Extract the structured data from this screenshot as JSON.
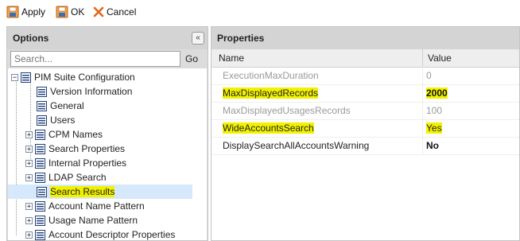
{
  "toolbar": {
    "apply_label": "Apply",
    "ok_label": "OK",
    "cancel_label": "Cancel"
  },
  "options": {
    "title": "Options",
    "collapse_symbol": "«",
    "search_placeholder": "Search...",
    "go_label": "Go",
    "tree": {
      "root": "PIM Suite Configuration",
      "items": [
        "Version Information",
        "General",
        "Users",
        "CPM Names",
        "Search Properties",
        "Internal Properties",
        "LDAP Search",
        "Search Results",
        "Account Name Pattern",
        "Usage Name Pattern",
        "Account Descriptor Properties"
      ]
    }
  },
  "properties": {
    "title": "Properties",
    "col_name": "Name",
    "col_value": "Value",
    "rows": [
      {
        "name": "ExecutionMaxDuration",
        "value": "0"
      },
      {
        "name": "MaxDisplayedRecords",
        "value": "2000"
      },
      {
        "name": "MaxDisplayedUsagesRecords",
        "value": "100"
      },
      {
        "name": "WideAccountsSearch",
        "value": "Yes"
      },
      {
        "name": "DisplaySearchAllAccountsWarning",
        "value": "No"
      }
    ]
  },
  "colors": {
    "highlight": "#f2f200",
    "selection": "#d6e8fb",
    "panel_header": "#d4d4d4"
  }
}
